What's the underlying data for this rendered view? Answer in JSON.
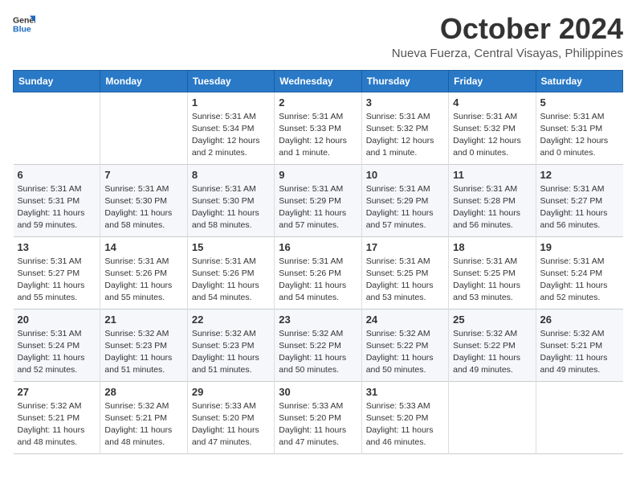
{
  "logo": {
    "general": "General",
    "blue": "Blue"
  },
  "header": {
    "title": "October 2024",
    "subtitle": "Nueva Fuerza, Central Visayas, Philippines"
  },
  "columns": [
    "Sunday",
    "Monday",
    "Tuesday",
    "Wednesday",
    "Thursday",
    "Friday",
    "Saturday"
  ],
  "weeks": [
    [
      {
        "day": "",
        "info": ""
      },
      {
        "day": "",
        "info": ""
      },
      {
        "day": "1",
        "info": "Sunrise: 5:31 AM\nSunset: 5:34 PM\nDaylight: 12 hours\nand 2 minutes."
      },
      {
        "day": "2",
        "info": "Sunrise: 5:31 AM\nSunset: 5:33 PM\nDaylight: 12 hours\nand 1 minute."
      },
      {
        "day": "3",
        "info": "Sunrise: 5:31 AM\nSunset: 5:32 PM\nDaylight: 12 hours\nand 1 minute."
      },
      {
        "day": "4",
        "info": "Sunrise: 5:31 AM\nSunset: 5:32 PM\nDaylight: 12 hours\nand 0 minutes."
      },
      {
        "day": "5",
        "info": "Sunrise: 5:31 AM\nSunset: 5:31 PM\nDaylight: 12 hours\nand 0 minutes."
      }
    ],
    [
      {
        "day": "6",
        "info": "Sunrise: 5:31 AM\nSunset: 5:31 PM\nDaylight: 11 hours\nand 59 minutes."
      },
      {
        "day": "7",
        "info": "Sunrise: 5:31 AM\nSunset: 5:30 PM\nDaylight: 11 hours\nand 58 minutes."
      },
      {
        "day": "8",
        "info": "Sunrise: 5:31 AM\nSunset: 5:30 PM\nDaylight: 11 hours\nand 58 minutes."
      },
      {
        "day": "9",
        "info": "Sunrise: 5:31 AM\nSunset: 5:29 PM\nDaylight: 11 hours\nand 57 minutes."
      },
      {
        "day": "10",
        "info": "Sunrise: 5:31 AM\nSunset: 5:29 PM\nDaylight: 11 hours\nand 57 minutes."
      },
      {
        "day": "11",
        "info": "Sunrise: 5:31 AM\nSunset: 5:28 PM\nDaylight: 11 hours\nand 56 minutes."
      },
      {
        "day": "12",
        "info": "Sunrise: 5:31 AM\nSunset: 5:27 PM\nDaylight: 11 hours\nand 56 minutes."
      }
    ],
    [
      {
        "day": "13",
        "info": "Sunrise: 5:31 AM\nSunset: 5:27 PM\nDaylight: 11 hours\nand 55 minutes."
      },
      {
        "day": "14",
        "info": "Sunrise: 5:31 AM\nSunset: 5:26 PM\nDaylight: 11 hours\nand 55 minutes."
      },
      {
        "day": "15",
        "info": "Sunrise: 5:31 AM\nSunset: 5:26 PM\nDaylight: 11 hours\nand 54 minutes."
      },
      {
        "day": "16",
        "info": "Sunrise: 5:31 AM\nSunset: 5:26 PM\nDaylight: 11 hours\nand 54 minutes."
      },
      {
        "day": "17",
        "info": "Sunrise: 5:31 AM\nSunset: 5:25 PM\nDaylight: 11 hours\nand 53 minutes."
      },
      {
        "day": "18",
        "info": "Sunrise: 5:31 AM\nSunset: 5:25 PM\nDaylight: 11 hours\nand 53 minutes."
      },
      {
        "day": "19",
        "info": "Sunrise: 5:31 AM\nSunset: 5:24 PM\nDaylight: 11 hours\nand 52 minutes."
      }
    ],
    [
      {
        "day": "20",
        "info": "Sunrise: 5:31 AM\nSunset: 5:24 PM\nDaylight: 11 hours\nand 52 minutes."
      },
      {
        "day": "21",
        "info": "Sunrise: 5:32 AM\nSunset: 5:23 PM\nDaylight: 11 hours\nand 51 minutes."
      },
      {
        "day": "22",
        "info": "Sunrise: 5:32 AM\nSunset: 5:23 PM\nDaylight: 11 hours\nand 51 minutes."
      },
      {
        "day": "23",
        "info": "Sunrise: 5:32 AM\nSunset: 5:22 PM\nDaylight: 11 hours\nand 50 minutes."
      },
      {
        "day": "24",
        "info": "Sunrise: 5:32 AM\nSunset: 5:22 PM\nDaylight: 11 hours\nand 50 minutes."
      },
      {
        "day": "25",
        "info": "Sunrise: 5:32 AM\nSunset: 5:22 PM\nDaylight: 11 hours\nand 49 minutes."
      },
      {
        "day": "26",
        "info": "Sunrise: 5:32 AM\nSunset: 5:21 PM\nDaylight: 11 hours\nand 49 minutes."
      }
    ],
    [
      {
        "day": "27",
        "info": "Sunrise: 5:32 AM\nSunset: 5:21 PM\nDaylight: 11 hours\nand 48 minutes."
      },
      {
        "day": "28",
        "info": "Sunrise: 5:32 AM\nSunset: 5:21 PM\nDaylight: 11 hours\nand 48 minutes."
      },
      {
        "day": "29",
        "info": "Sunrise: 5:33 AM\nSunset: 5:20 PM\nDaylight: 11 hours\nand 47 minutes."
      },
      {
        "day": "30",
        "info": "Sunrise: 5:33 AM\nSunset: 5:20 PM\nDaylight: 11 hours\nand 47 minutes."
      },
      {
        "day": "31",
        "info": "Sunrise: 5:33 AM\nSunset: 5:20 PM\nDaylight: 11 hours\nand 46 minutes."
      },
      {
        "day": "",
        "info": ""
      },
      {
        "day": "",
        "info": ""
      }
    ]
  ]
}
